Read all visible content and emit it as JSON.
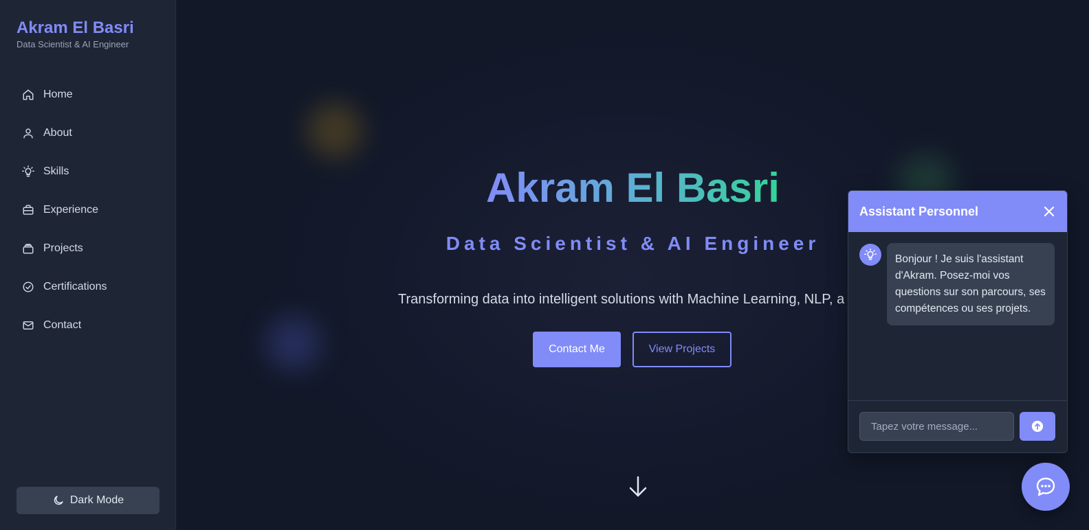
{
  "sidebar": {
    "brand_name": "Akram El Basri",
    "brand_subtitle": "Data Scientist & AI Engineer",
    "items": [
      {
        "label": "Home",
        "icon": "home-icon"
      },
      {
        "label": "About",
        "icon": "user-icon"
      },
      {
        "label": "Skills",
        "icon": "lightbulb-icon"
      },
      {
        "label": "Experience",
        "icon": "briefcase-icon"
      },
      {
        "label": "Projects",
        "icon": "folder-icon"
      },
      {
        "label": "Certifications",
        "icon": "check-circle-icon"
      },
      {
        "label": "Contact",
        "icon": "mail-icon"
      }
    ],
    "theme_toggle_label": "Dark Mode"
  },
  "hero": {
    "name": "Akram El Basri",
    "role": "Data Scientist & AI Engineer",
    "description": "Transforming data into intelligent solutions with Machine Learning, NLP, a",
    "contact_button": "Contact Me",
    "projects_button": "View Projects"
  },
  "chat": {
    "title": "Assistant Personnel",
    "welcome_message": "Bonjour ! Je suis l'assistant d'Akram. Posez-moi vos questions sur son parcours, ses compétences ou ses projets.",
    "input_placeholder": "Tapez votre message..."
  },
  "colors": {
    "accent": "#818cf8",
    "gradient_end": "#34d399",
    "sidebar_bg": "#1e2535",
    "page_bg": "#131a2b"
  }
}
